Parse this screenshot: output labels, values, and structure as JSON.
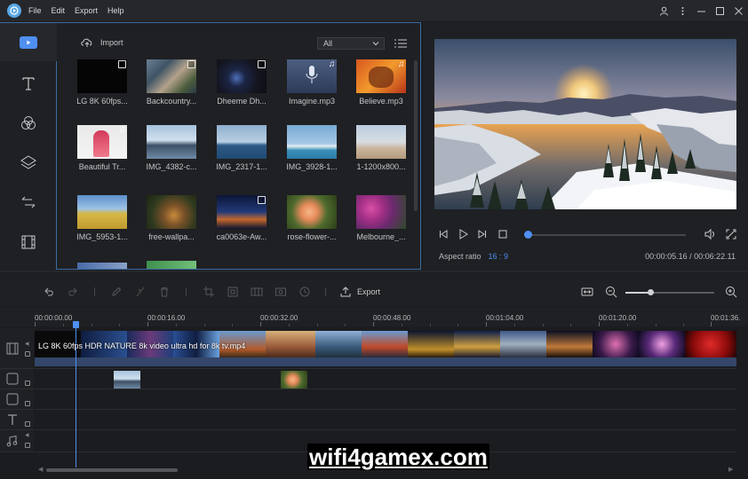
{
  "menu": [
    "File",
    "Edit",
    "Export",
    "Help"
  ],
  "media": {
    "import_label": "Import",
    "filter_value": "All",
    "items": [
      {
        "label": "LG 8K 60fps...",
        "kind": "video"
      },
      {
        "label": "Backcountry...",
        "kind": "video"
      },
      {
        "label": "Dheeme Dh...",
        "kind": "video"
      },
      {
        "label": "Imagine.mp3",
        "kind": "music"
      },
      {
        "label": "Believe.mp3",
        "kind": "music"
      },
      {
        "label": "Beautiful Tr...",
        "kind": "music"
      },
      {
        "label": "IMG_4382-c...",
        "kind": "image"
      },
      {
        "label": "IMG_2317-1...",
        "kind": "image"
      },
      {
        "label": "IMG_3928-1...",
        "kind": "image"
      },
      {
        "label": "1-1200x800...",
        "kind": "image"
      },
      {
        "label": "IMG_5953-1...",
        "kind": "image"
      },
      {
        "label": "free-wallpa...",
        "kind": "image"
      },
      {
        "label": "ca0063e-Aw...",
        "kind": "video"
      },
      {
        "label": "rose-flower-...",
        "kind": "image"
      },
      {
        "label": "Melbourne_...",
        "kind": "image"
      }
    ]
  },
  "preview": {
    "aspect_label": "Aspect ratio",
    "aspect_value": "16 : 9",
    "timecode": "00:00:05.16 / 00:06:22.11",
    "progress": 0.014
  },
  "toolbar": {
    "export_label": "Export",
    "zoom_level": 0.28
  },
  "ruler": [
    "00:00:00.00",
    "00:00:16.00",
    "00:00:32.00",
    "00:00:48.00",
    "00:01:04.00",
    "00:01:20.00",
    "00:01:36."
  ],
  "timeline": {
    "video_clip_label": "LG 8K 60fps HDR NATURE 8k video ultra hd for 8k tv.mp4"
  },
  "watermark": "wifi4gamex.com",
  "colors": {
    "accent": "#4f8ff0",
    "panel": "#1f2023",
    "border": "#3a6ea5"
  }
}
